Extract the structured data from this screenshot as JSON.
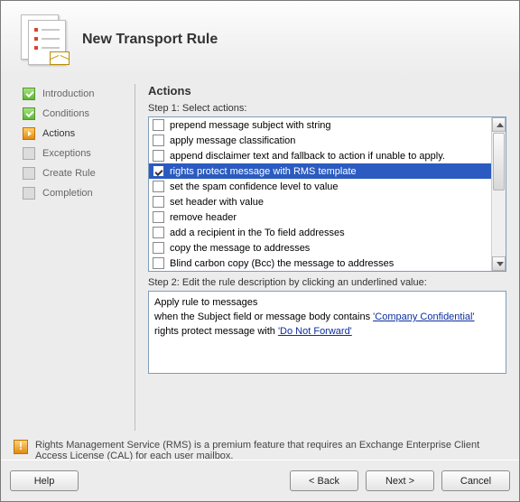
{
  "header": {
    "title": "New Transport Rule"
  },
  "sidebar": {
    "items": [
      {
        "label": "Introduction",
        "state": "done"
      },
      {
        "label": "Conditions",
        "state": "done"
      },
      {
        "label": "Actions",
        "state": "current"
      },
      {
        "label": "Exceptions",
        "state": "pending"
      },
      {
        "label": "Create Rule",
        "state": "pending"
      },
      {
        "label": "Completion",
        "state": "pending"
      }
    ]
  },
  "main": {
    "section_title": "Actions",
    "step1_label": "Step 1: Select actions:",
    "actions": [
      {
        "label": "prepend message subject with string",
        "checked": false,
        "selected": false
      },
      {
        "label": "apply message classification",
        "checked": false,
        "selected": false
      },
      {
        "label": "append disclaimer text and fallback to action if unable to apply.",
        "checked": false,
        "selected": false
      },
      {
        "label": "rights protect message with RMS template",
        "checked": true,
        "selected": true
      },
      {
        "label": "set the spam confidence level to value",
        "checked": false,
        "selected": false
      },
      {
        "label": "set header with value",
        "checked": false,
        "selected": false
      },
      {
        "label": "remove header",
        "checked": false,
        "selected": false
      },
      {
        "label": "add a recipient in the To field addresses",
        "checked": false,
        "selected": false
      },
      {
        "label": "copy the message to addresses",
        "checked": false,
        "selected": false
      },
      {
        "label": "Blind carbon copy (Bcc) the message to addresses",
        "checked": false,
        "selected": false
      }
    ],
    "step2_label": "Step 2: Edit the rule description by clicking an underlined value:",
    "description": {
      "line1": "Apply rule to messages",
      "line2_prefix": "when the Subject field or message body contains ",
      "line2_link": "'Company Confidential'",
      "line3_prefix": "rights protect message with ",
      "line3_link": "'Do Not Forward'"
    },
    "note": "Rights Management Service (RMS) is a premium feature that requires an Exchange Enterprise Client Access License (CAL) for each user mailbox."
  },
  "buttons": {
    "help": "Help",
    "back": "< Back",
    "next": "Next >",
    "cancel": "Cancel"
  }
}
